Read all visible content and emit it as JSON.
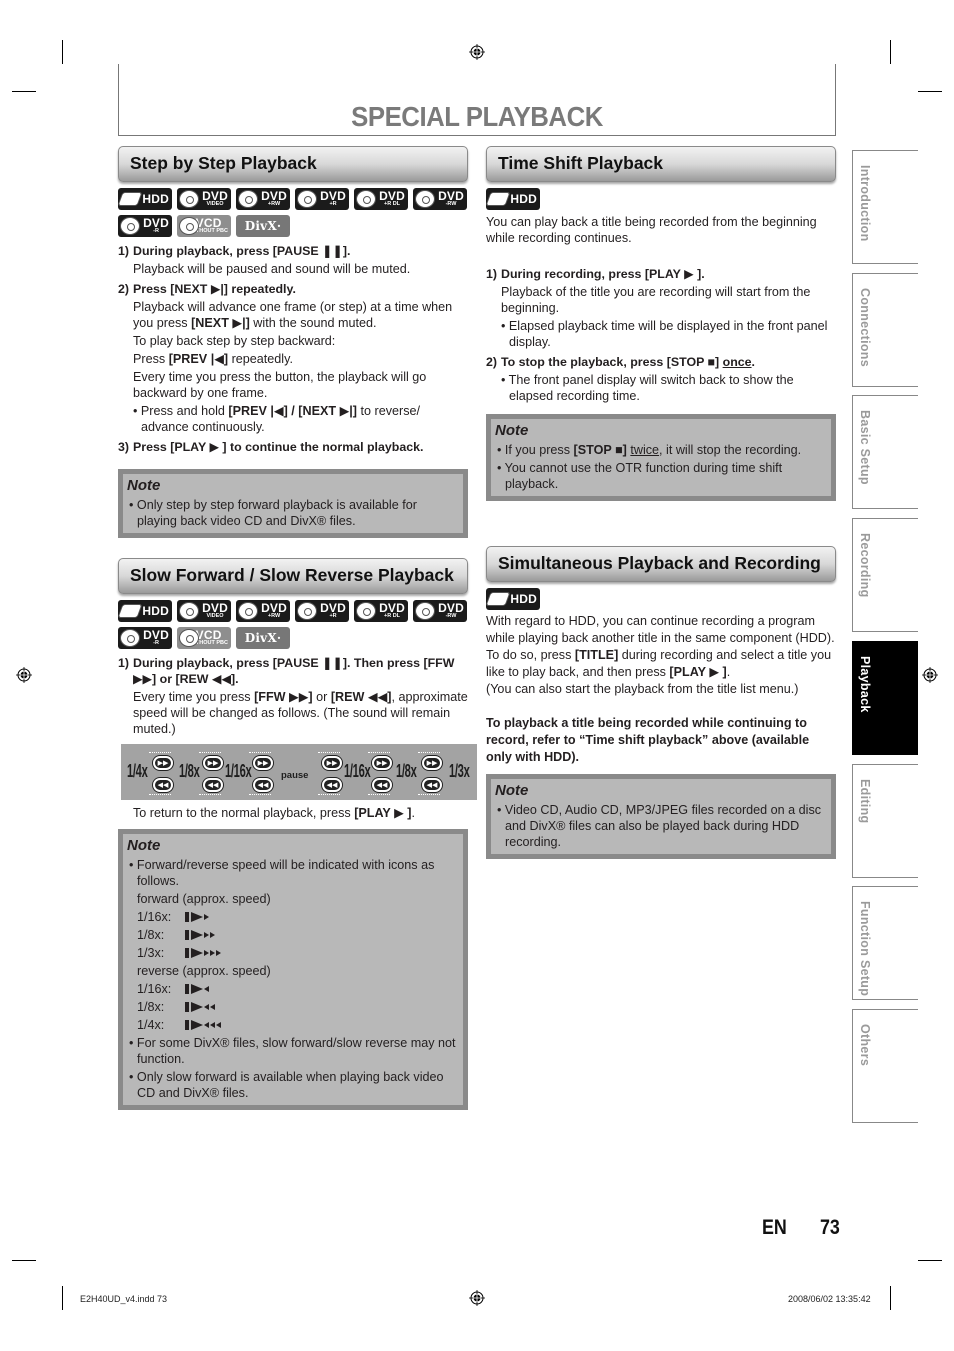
{
  "page": {
    "title": "SPECIAL PLAYBACK",
    "lang": "EN",
    "number": "73",
    "slug_file": "E2H40UD_v4.indd   73",
    "slug_date": "2008/06/02   13:35:42"
  },
  "side_tabs": [
    {
      "label": "Introduction",
      "active": false
    },
    {
      "label": "Connections",
      "active": false
    },
    {
      "label": "Basic Setup",
      "active": false
    },
    {
      "label": "Recording",
      "active": false
    },
    {
      "label": "Playback",
      "active": true
    },
    {
      "label": "Editing",
      "active": false
    },
    {
      "label": "Function Setup",
      "active": false
    },
    {
      "label": "Others",
      "active": false
    }
  ],
  "media_badges": [
    {
      "main": "HDD",
      "sub": "",
      "style": "hdd"
    },
    {
      "main": "DVD",
      "sub": "VIDEO",
      "style": "dark"
    },
    {
      "main": "DVD",
      "sub": "+RW",
      "style": "dark"
    },
    {
      "main": "DVD",
      "sub": "+R",
      "style": "dark"
    },
    {
      "main": "DVD",
      "sub": "+R DL",
      "style": "dark"
    },
    {
      "main": "DVD",
      "sub": "-RW",
      "style": "dark"
    },
    {
      "main": "DVD",
      "sub": "-R",
      "style": "dark"
    },
    {
      "main": "VCD",
      "sub": "WITHOUT PBC",
      "style": "gray"
    },
    {
      "main": "DivX·",
      "sub": "",
      "style": "divx"
    }
  ],
  "hdd_badge": {
    "main": "HDD"
  },
  "step_by_step": {
    "heading": "Step by Step Playback",
    "s1_num": "1)",
    "s1_head": "During playback, press [PAUSE ❚❚].",
    "s1_p": "Playback will be paused and sound will be muted.",
    "s2_num": "2)",
    "s2_head": "Press [NEXT ▶|] repeatedly.",
    "s2_p1a": "Playback will advance one frame (or step) at a time when you press ",
    "s2_p1b": "[NEXT ▶|]",
    "s2_p1c": " with the sound muted.",
    "s2_p2": "To play back step by step backward:",
    "s2_p3a": "Press ",
    "s2_p3b": "[PREV |◀]",
    "s2_p3c": " repeatedly.",
    "s2_p4": "Every time you press the button, the playback will go backward by one frame.",
    "s2_b1a": "• Press and hold ",
    "s2_b1b": "[PREV |◀] / [NEXT ▶|]",
    "s2_b1c": " to reverse/ advance continuously.",
    "s3_num": "3)",
    "s3_head": "Press [PLAY ▶ ] to continue the normal playback.",
    "note_heading": "Note",
    "note_1": "• Only step by step forward playback is available for playing back video CD and DivX® files."
  },
  "slow": {
    "heading": "Slow Forward / Slow Reverse Playback",
    "s1_num": "1)",
    "s1_head": "During playback, press [PAUSE ❚❚]. Then press [FFW ▶▶] or [REW ◀◀].",
    "s1_pa": "Every time you press ",
    "s1_pb": "[FFW ▶▶]",
    "s1_pc": " or ",
    "s1_pd": "[REW ◀◀]",
    "s1_pe": ", approximate speed will be changed as follows. (The sound will remain muted.)",
    "speeds": [
      "1/4x",
      "1/8x",
      "1/16x",
      "pause",
      "1/16x",
      "1/8x",
      "1/3x"
    ],
    "return_a": "To return to the normal playback, press ",
    "return_b": "[PLAY ▶ ]",
    "return_c": ".",
    "note_heading": "Note",
    "note_1": "• Forward/reverse speed will be indicated with icons as follows.",
    "forward_label": "forward (approx. speed)",
    "forward": [
      {
        "label": "1/16x:",
        "arrows": 1
      },
      {
        "label": "1/8x:",
        "arrows": 2
      },
      {
        "label": "1/3x:",
        "arrows": 3
      }
    ],
    "reverse_label": "reverse (approx. speed)",
    "reverse": [
      {
        "label": "1/16x:",
        "arrows": 1
      },
      {
        "label": "1/8x:",
        "arrows": 2
      },
      {
        "label": "1/4x:",
        "arrows": 3
      }
    ],
    "note_2": "• For some DivX® files, slow forward/slow reverse may not function.",
    "note_3": "• Only slow forward is available when playing back video CD and DivX® files."
  },
  "time_shift": {
    "heading": "Time Shift Playback",
    "intro": "You can play back a title being recorded from the beginning while recording continues.",
    "s1_num": "1)",
    "s1_head": "During recording, press [PLAY ▶ ].",
    "s1_p": "Playback of the title you are recording will start from the beginning.",
    "s1_b": "• Elapsed playback time will be displayed in the front panel display.",
    "s2_num": "2)",
    "s2_head_a": "To stop the playback, press [STOP ■] ",
    "s2_head_b": "once",
    "s2_head_c": ".",
    "s2_b": "• The front panel display will switch back to show the elapsed recording time.",
    "note_heading": "Note",
    "note_1a": "• If you press ",
    "note_1b": "[STOP ■]",
    "note_1c": " ",
    "note_1d": "twice",
    "note_1e": ", it will stop the recording.",
    "note_2": "• You cannot use the OTR function during time shift playback."
  },
  "simultaneous": {
    "heading": "Simultaneous Playback and Recording",
    "p1": "With regard to HDD, you can continue recording a program while playing back another title in the same component (HDD).",
    "p2a": "To do so, press ",
    "p2b": "[TITLE]",
    "p2c": " during recording and select a title you like to play back, and then press ",
    "p2d": "[PLAY ▶ ]",
    "p2e": ".",
    "p3": "(You can also start the playback from the title list menu.)",
    "bold_p": "To playback a title being recorded while continuing to record, refer to “Time shift playback” above (available only with HDD).",
    "note_heading": "Note",
    "note_1": "• Video CD, Audio CD, MP3/JPEG files recorded on a disc and DivX® files can also be played back during HDD recording."
  }
}
